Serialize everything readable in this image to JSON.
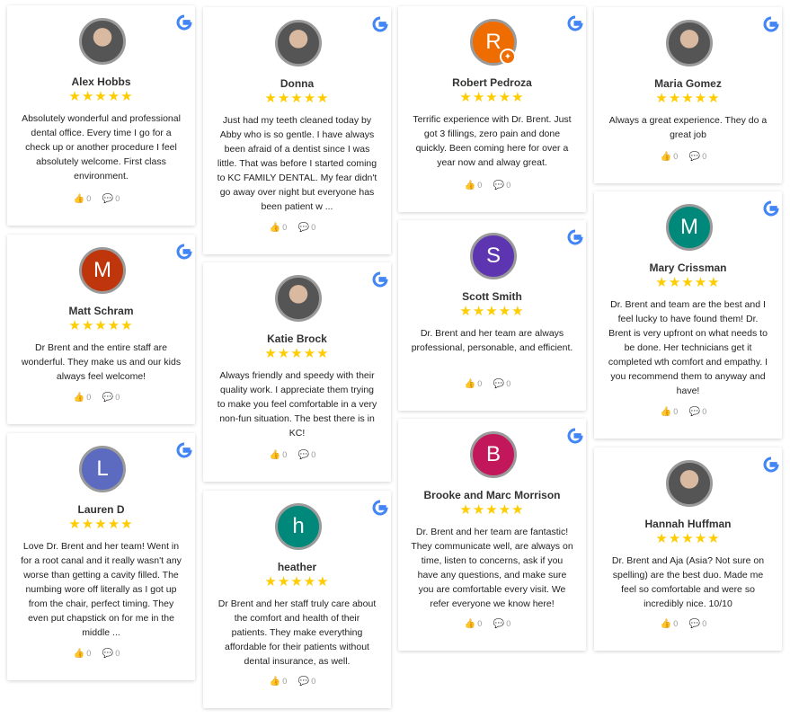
{
  "cards": [
    {
      "name": "Alex Hobbs",
      "text": "Absolutely wonderful and professional dental office. Every time I go for a check up or another procedure I feel absolutely welcome. First class environment.",
      "likes": "0",
      "comments": "0",
      "avatar_type": "photo"
    },
    {
      "name": "Matt Schram",
      "text": "Dr Brent and the entire staff are wonderful. They make us and our kids always feel welcome!",
      "likes": "0",
      "comments": "0",
      "initial": "M",
      "color": "#bf360c"
    },
    {
      "name": "Lauren D",
      "text": "Love Dr. Brent and her team! Went in for a root canal and it really wasn't any worse than getting a cavity filled. The numbing wore off literally as I got up from the chair, perfect timing. They even put chapstick on for me in the middle ...",
      "likes": "0",
      "comments": "0",
      "initial": "L",
      "color": "#5c6bc0"
    },
    {
      "name": "Donna",
      "text": "Just had my teeth cleaned today by Abby who is so gentle. I have always been afraid of a dentist since I was little. That was before I started coming to KC FAMILY DENTAL. My fear didn't go away over night but everyone has been patient w ...",
      "likes": "0",
      "comments": "0",
      "avatar_type": "photo"
    },
    {
      "name": "Katie Brock",
      "text": "Always friendly and speedy with their quality work. I appreciate them trying to make you feel comfortable in a very non-fun situation. The best there is in KC!",
      "likes": "0",
      "comments": "0",
      "avatar_type": "photo"
    },
    {
      "name": "heather",
      "text": "Dr Brent and her staff truly care about the comfort and health of their patients. They make everything affordable for their patients without dental insurance, as well.",
      "likes": "0",
      "comments": "0",
      "initial": "h",
      "color": "#00897b"
    },
    {
      "name": "Robert Pedroza",
      "text": "Terrific experience with Dr. Brent. Just got 3 fillings, zero pain and done quickly. Been coming here for over a year now and alway great.",
      "likes": "0",
      "comments": "0",
      "initial": "R",
      "color": "#ef6c00"
    },
    {
      "name": "Scott Smith",
      "text": "Dr. Brent and her team are always professional, personable, and efficient.",
      "likes": "0",
      "comments": "0",
      "initial": "S",
      "color": "#5e35b1"
    },
    {
      "name": "Brooke and Marc Morrison",
      "text": "Dr. Brent and her team are fantastic! They communicate well, are always on time, listen to concerns, ask if you have any questions, and make sure you are comfortable every visit. We refer everyone we know here!",
      "likes": "0",
      "comments": "0",
      "initial": "B",
      "color": "#c2185b"
    },
    {
      "name": "Maria Gomez",
      "text": "Always a great experience. They do a great job",
      "likes": "0",
      "comments": "0",
      "avatar_type": "photo"
    },
    {
      "name": "Mary Crissman",
      "text": "Dr. Brent and team are the best and I feel lucky to have found them! Dr. Brent is very upfront on what needs to be done. Her technicians get it completed wth comfort and empathy. I you recommend them to anyway and have!",
      "likes": "0",
      "comments": "0",
      "initial": "M",
      "color": "#00897b"
    },
    {
      "name": "Hannah Huffman",
      "text": "Dr. Brent and Aja (Asia? Not sure on spelling) are the best duo. Made me feel so comfortable and were so incredibly nice. 10/10",
      "likes": "0",
      "comments": "0",
      "avatar_type": "photo"
    }
  ],
  "stars": "★★★★★",
  "like_icon": "thumbs-up-icon",
  "comment_icon": "comment-icon"
}
